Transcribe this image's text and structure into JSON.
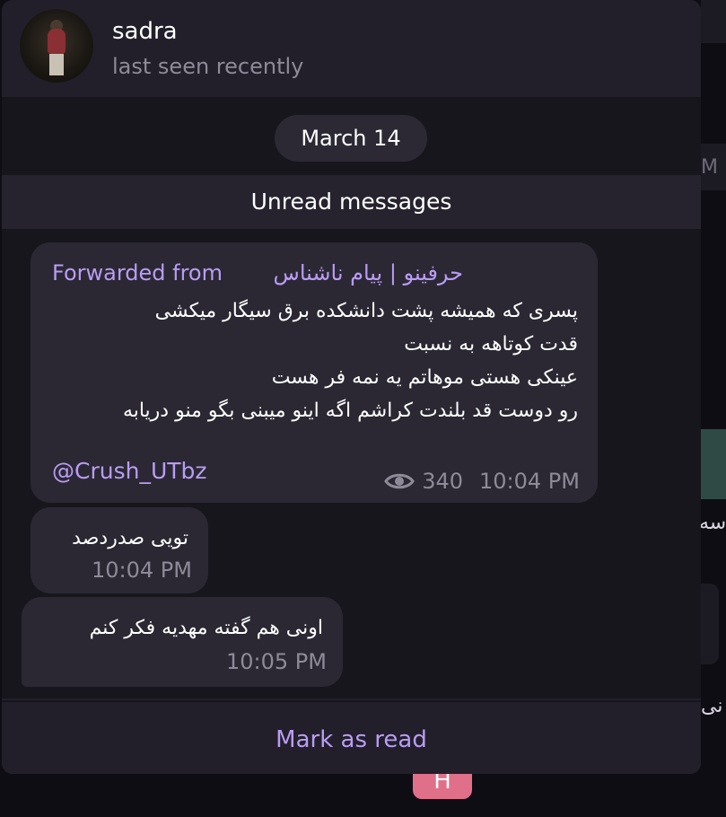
{
  "contact": {
    "name": "sadra",
    "status": "last seen recently"
  },
  "chat": {
    "date": "March 14",
    "unread_label": "Unread messages",
    "messages": [
      {
        "forwarded_prefix": "Forwarded from",
        "forwarded_source": "حرفینو | پیام ناشناس",
        "lines": [
          "پسری که همیشه پشت دانشکده برق سیگار میکشی",
          "قدت کوتاهه به نسبت",
          "عینکی هستی موهاتم یه نمه فر هست",
          "رو دوست قد بلندت کراشم اگه اینو میبنی بگو منو دریابه"
        ],
        "link": "@Crush_UTbz",
        "views": "340",
        "time": "10:04 PM"
      },
      {
        "text": "تویی صدردصد",
        "time": "10:04 PM"
      },
      {
        "text": "اونی هم گفته مهدیه فکر کنم",
        "time": "10:05 PM"
      }
    ]
  },
  "footer": {
    "mark_read_label": "Mark as read"
  },
  "background": {
    "peek_m": "M",
    "peek_text_1": "سه",
    "peek_text_2": "نی",
    "peek_h": "H"
  },
  "colors": {
    "accent": "#b99cf5",
    "panel": "#221f2a",
    "bubble": "#2b2833",
    "muted": "#8e8a97"
  }
}
